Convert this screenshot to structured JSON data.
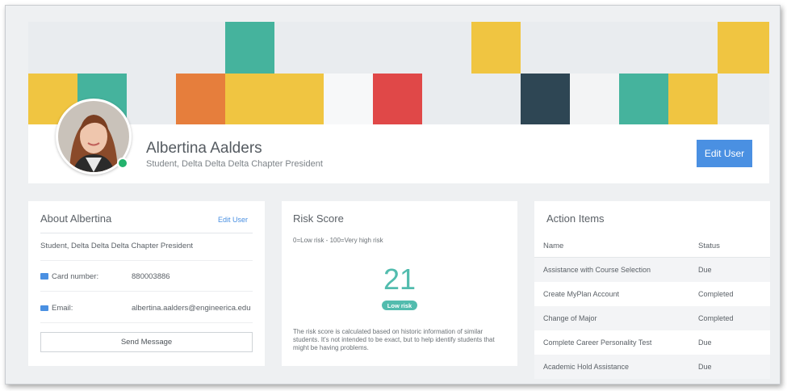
{
  "banner": {
    "colors": {
      "yellow": "#f0c541",
      "teal": "#45b39d",
      "orange": "#e67e3c",
      "red": "#e04848",
      "navy": "#2e4654",
      "white": "#f7f8f9",
      "gray": "#e9ecef"
    }
  },
  "profile": {
    "name": "Albertina Aalders",
    "subtitle": "Student, Delta Delta Delta Chapter President",
    "status": "online",
    "edit_label": "Edit User"
  },
  "about": {
    "title": "About Albertina",
    "edit_label": "Edit User",
    "subtitle": "Student, Delta Delta Delta Chapter President",
    "card_label": "Card number:",
    "card_value": "880003886",
    "email_label": "Email:",
    "email_value": "albertina.aalders@engineerica.edu",
    "send_label": "Send Message"
  },
  "risk": {
    "title": "Risk Score",
    "scale": "0=Low risk - 100=Very high risk",
    "score": "21",
    "badge": "Low risk",
    "note": "The risk score is calculated based on historic information of similar students. It's not intended to be exact, but to help identify students that might be having problems.",
    "accent": "#52bcae"
  },
  "actions": {
    "title": "Action Items",
    "col_name": "Name",
    "col_status": "Status",
    "rows": [
      {
        "name": "Assistance with Course Selection",
        "status": "Due"
      },
      {
        "name": "Create MyPlan Account",
        "status": "Completed"
      },
      {
        "name": "Change of Major",
        "status": "Completed"
      },
      {
        "name": "Complete Career Personality Test",
        "status": "Due"
      },
      {
        "name": "Academic Hold Assistance",
        "status": "Due"
      }
    ]
  },
  "accent_color": "#4a90e2"
}
